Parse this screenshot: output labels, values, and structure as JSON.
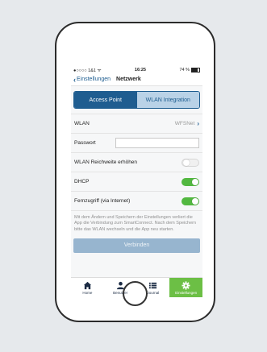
{
  "status": {
    "carrier": "●○○○○ 1&1 ",
    "wifi": "ᯤ",
    "time": "16:25",
    "battery": "74 %"
  },
  "nav": {
    "back_label": "Einstellungen",
    "title": "Netzwerk"
  },
  "segments": {
    "option1": "Access Point",
    "option2": "WLAN Integration"
  },
  "wlan": {
    "label": "WLAN",
    "value": "WFSNet"
  },
  "password": {
    "label": "Passwort",
    "value": ""
  },
  "range": {
    "label": "WLAN Reichweite erhöhen",
    "on": false
  },
  "dhcp": {
    "label": "DHCP",
    "on": true
  },
  "remote": {
    "label": "Fernzugriff (via Internet)",
    "on": true
  },
  "info_text": "Mit dem Ändern und Speichern der Einstellungen verliert die App die Verbindung zum SmartConnect. Nach dem Speichern bitte das WLAN wechseln und die App neu starten.",
  "connect_label": "Verbinden",
  "tabs": [
    {
      "label": "Home",
      "icon": "home-icon"
    },
    {
      "label": "Benutzer",
      "icon": "user-icon"
    },
    {
      "label": "Journal",
      "icon": "list-icon"
    },
    {
      "label": "Einstellungen",
      "icon": "gear-icon"
    }
  ],
  "colors": {
    "primary": "#1f5d90",
    "segment_inactive": "#b9d2e7",
    "toggle_on": "#52b840",
    "tab_active": "#6cbf45",
    "button_disabled": "#97b5cf"
  }
}
